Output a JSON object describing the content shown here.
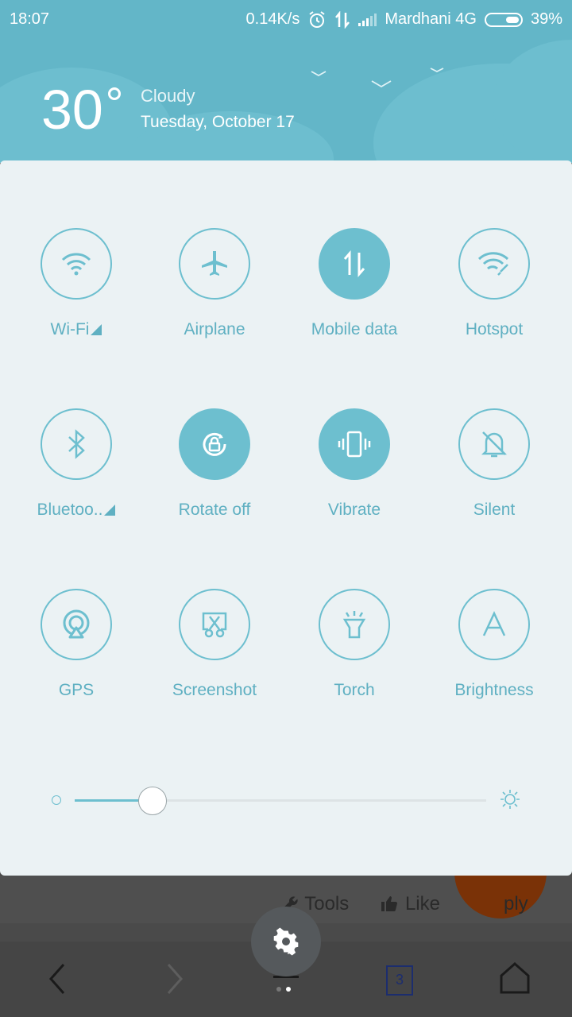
{
  "status_bar": {
    "time": "18:07",
    "net_speed": "0.14K/s",
    "carrier": "Mardhani 4G",
    "battery": "39%"
  },
  "weather": {
    "temperature": "30",
    "condition": "Cloudy",
    "date": "Tuesday, October 17"
  },
  "toggles": [
    {
      "label": "Wi-Fi",
      "icon": "wifi-icon",
      "active": false,
      "has_menu": true
    },
    {
      "label": "Airplane",
      "icon": "airplane-icon",
      "active": false,
      "has_menu": false
    },
    {
      "label": "Mobile data",
      "icon": "mobile-data-icon",
      "active": true,
      "has_menu": false
    },
    {
      "label": "Hotspot",
      "icon": "hotspot-icon",
      "active": false,
      "has_menu": false
    },
    {
      "label": "Bluetoo..",
      "icon": "bluetooth-icon",
      "active": false,
      "has_menu": true
    },
    {
      "label": "Rotate off",
      "icon": "rotate-lock-icon",
      "active": true,
      "has_menu": false
    },
    {
      "label": "Vibrate",
      "icon": "vibrate-icon",
      "active": true,
      "has_menu": false
    },
    {
      "label": "Silent",
      "icon": "silent-bell-icon",
      "active": false,
      "has_menu": false
    },
    {
      "label": "GPS",
      "icon": "gps-icon",
      "active": false,
      "has_menu": false
    },
    {
      "label": "Screenshot",
      "icon": "screenshot-scissors-icon",
      "active": false,
      "has_menu": false
    },
    {
      "label": "Torch",
      "icon": "torch-icon",
      "active": false,
      "has_menu": false
    },
    {
      "label": "Brightness",
      "icon": "brightness-auto-icon",
      "active": false,
      "has_menu": false
    }
  ],
  "brightness": {
    "level": 0.19
  },
  "background_app": {
    "tools_label": "Tools",
    "like_label": "Like",
    "reply_partial": "ply"
  },
  "nav": {
    "tabs_count": "3"
  },
  "colors": {
    "accent": "#6dbfcf",
    "header": "#63b6c8",
    "panel": "#ebf2f4"
  }
}
